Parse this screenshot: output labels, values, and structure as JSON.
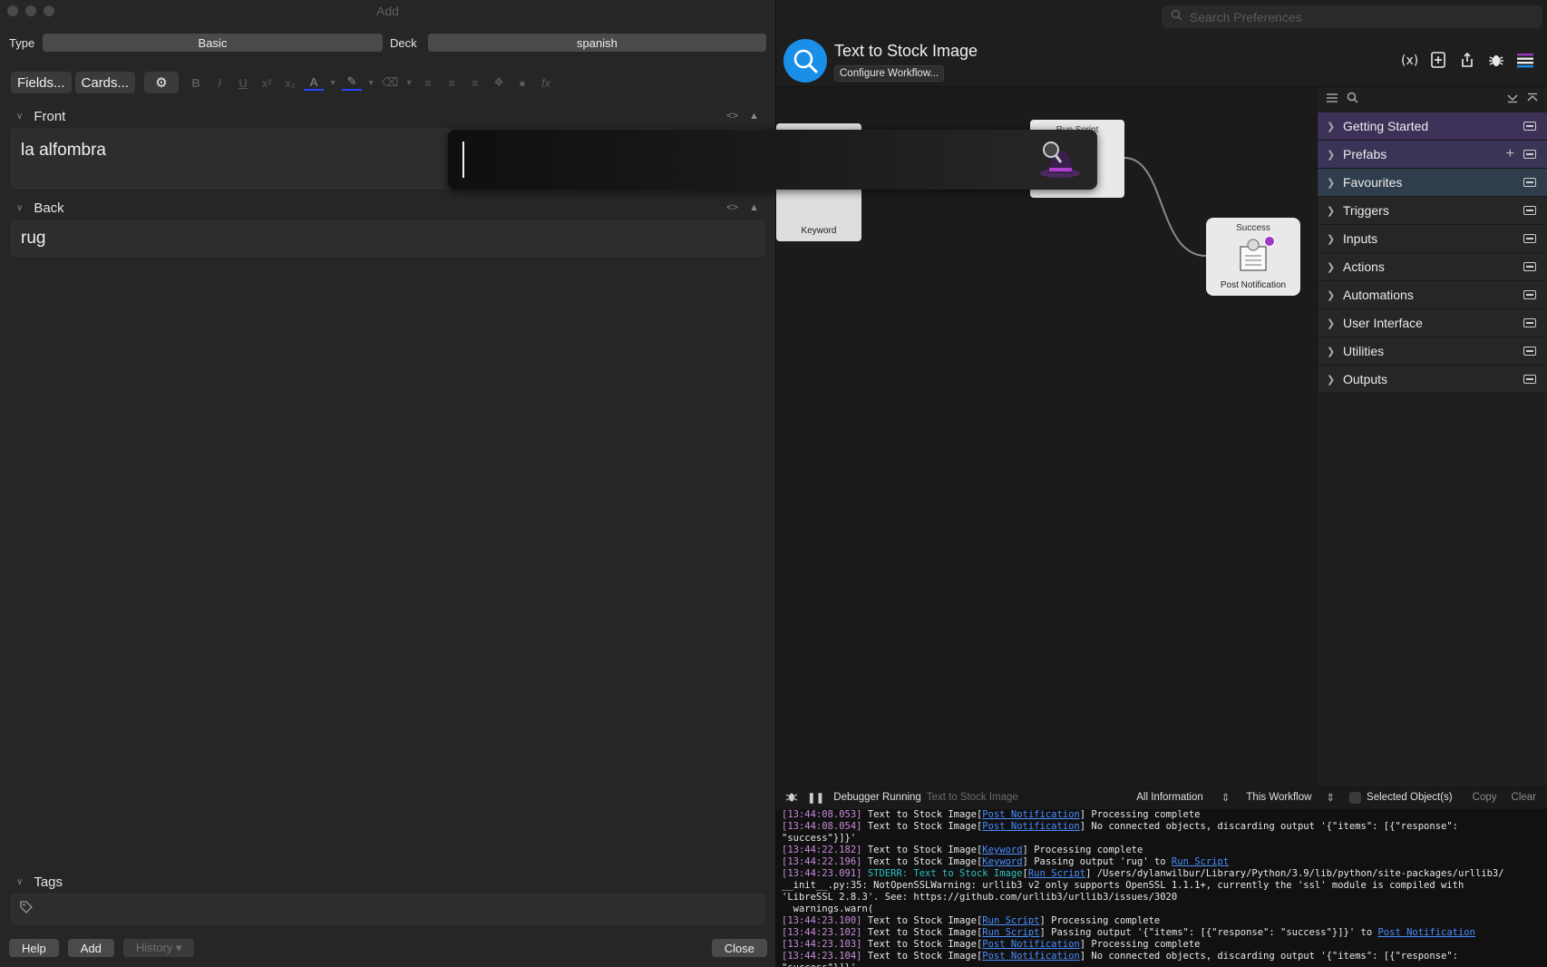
{
  "preferences": {
    "search_placeholder": "Search Preferences"
  },
  "workflow": {
    "title": "Text to Stock Image",
    "configure_label": "Configure Workflow...",
    "nodes": {
      "keyword_label": "Keyword",
      "script_title": "Run Script",
      "success_title": "Success",
      "success_label": "Post Notification"
    }
  },
  "objects_panel": {
    "items": [
      {
        "label": "Getting Started"
      },
      {
        "label": "Prefabs"
      },
      {
        "label": "Favourites"
      },
      {
        "label": "Triggers"
      },
      {
        "label": "Inputs"
      },
      {
        "label": "Actions"
      },
      {
        "label": "Automations"
      },
      {
        "label": "User Interface"
      },
      {
        "label": "Utilities"
      },
      {
        "label": "Outputs"
      }
    ]
  },
  "debugger": {
    "status": "Debugger Running",
    "workflow_name": "Text to Stock Image",
    "filter": "All Information",
    "scope": "This Workflow",
    "selected_objects": "Selected Object(s)",
    "copy": "Copy",
    "clear": "Clear"
  },
  "log": [
    {
      "ts": "[13:44:08.053]",
      "src": "Text to Stock Image",
      "obj": "Post Notification",
      "msg": " Processing complete"
    },
    {
      "ts": "[13:44:08.054]",
      "src": "Text to Stock Image",
      "obj": "Post Notification",
      "msg": " No connected objects, discarding output '{\"items\": [{\"response\":"
    },
    {
      "cont": "\"success\"}]}'"
    },
    {
      "ts": "[13:44:22.182]",
      "src": "Text to Stock Image",
      "obj": "Keyword",
      "msg": " Processing complete"
    },
    {
      "ts": "[13:44:22.196]",
      "src": "Text to Stock Image",
      "obj": "Keyword",
      "msg": " Passing output 'rug' to ",
      "link2": "Run Script"
    },
    {
      "ts": "[13:44:23.091]",
      "stderr": "STDERR: Text to Stock Image",
      "obj": "Run Script",
      "msg": " /Users/dylanwilbur/Library/Python/3.9/lib/python/site-packages/urllib3/"
    },
    {
      "cont": "__init__.py:35: NotOpenSSLWarning: urllib3 v2 only supports OpenSSL 1.1.1+, currently the 'ssl' module is compiled with"
    },
    {
      "cont": "'LibreSSL 2.8.3'. See: https://github.com/urllib3/urllib3/issues/3020"
    },
    {
      "cont": "  warnings.warn("
    },
    {
      "ts": "[13:44:23.100]",
      "src": "Text to Stock Image",
      "obj": "Run Script",
      "msg": " Processing complete"
    },
    {
      "ts": "[13:44:23.102]",
      "src": "Text to Stock Image",
      "obj": "Run Script",
      "msg": " Passing output '{\"items\": [{\"response\": \"success\"}]}' to ",
      "link2": "Post Notification"
    },
    {
      "ts": "[13:44:23.103]",
      "src": "Text to Stock Image",
      "obj": "Post Notification",
      "msg": " Processing complete"
    },
    {
      "ts": "[13:44:23.104]",
      "src": "Text to Stock Image",
      "obj": "Post Notification",
      "msg": " No connected objects, discarding output '{\"items\": [{\"response\":"
    },
    {
      "cont": "\"success\"}]}'"
    }
  ],
  "anki": {
    "window_title": "Add",
    "type_label": "Type",
    "type_value": "Basic",
    "deck_label": "Deck",
    "deck_value": "spanish",
    "fields_button": "Fields...",
    "cards_button": "Cards...",
    "front_label": "Front",
    "front_value": "la alfombra",
    "back_label": "Back",
    "back_value": "rug",
    "tags_label": "Tags",
    "help_button": "Help",
    "add_button": "Add",
    "history_button": "History ▾",
    "close_button": "Close"
  },
  "alfred_bar": {
    "query": ""
  },
  "colors": {
    "accent_blue": "#1a8fe8",
    "purple": "#9a39c4",
    "link": "#4a8cff"
  }
}
